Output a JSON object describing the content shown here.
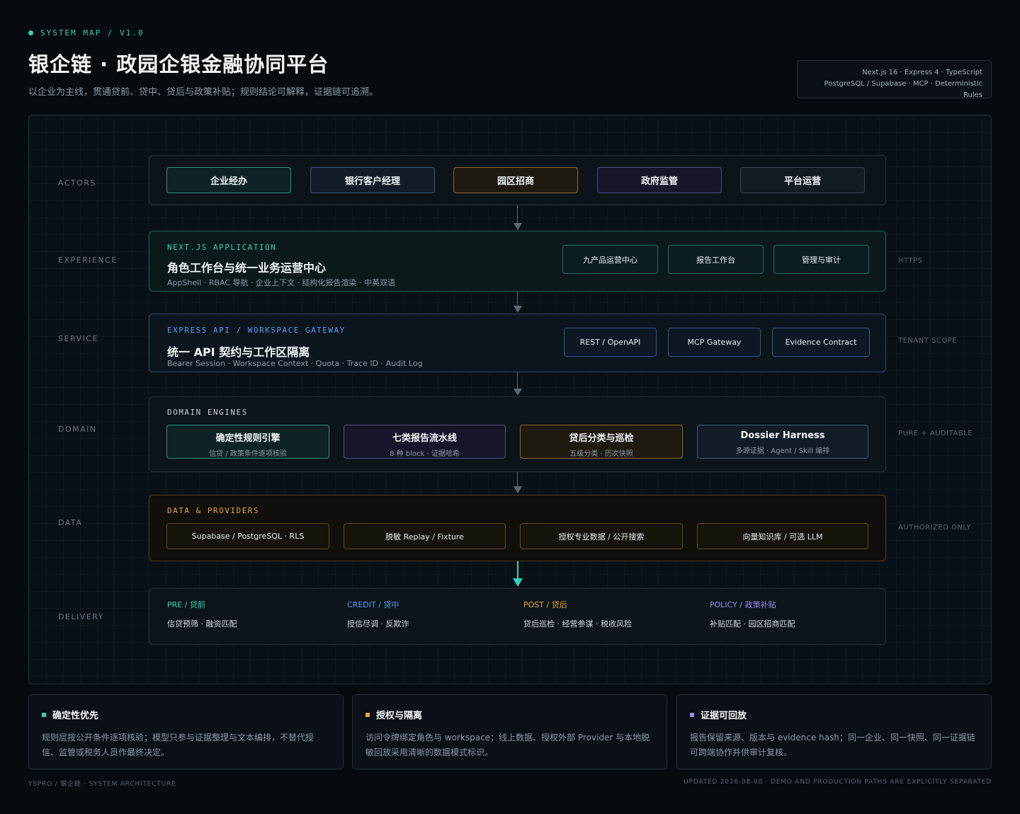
{
  "header": {
    "eyebrow": "SYSTEM MAP / V1.0",
    "title": "银企链 · 政园企银金融协同平台",
    "subtitle": "以企业为主线，贯通贷前、贷中、贷后与政策补贴；规则结论可解释，证据链可追溯。",
    "stack_line1": "Next.js 16 · Express 4 · TypeScript",
    "stack_line2": "PostgreSQL / Supabase · MCP · Deterministic Rules"
  },
  "rows": {
    "actors": "ACTORS",
    "experience": "EXPERIENCE",
    "service": "SERVICE",
    "domain": "DOMAIN",
    "data": "DATA",
    "delivery": "DELIVERY"
  },
  "side": {
    "experience": "HTTPS",
    "service": "TENANT SCOPE",
    "domain": "PURE + AUDITABLE",
    "data": "AUTHORIZED ONLY"
  },
  "actors": [
    {
      "label": "企业经办",
      "color": "#2f8f7e",
      "bg": "#0f2324"
    },
    {
      "label": "银行客户经理",
      "color": "#3d5a7a",
      "bg": "#111c28"
    },
    {
      "label": "园区招商",
      "color": "#8a6a2e",
      "bg": "#1e1a12"
    },
    {
      "label": "政府监管",
      "color": "#4f4e82",
      "bg": "#16162a"
    },
    {
      "label": "平台运营",
      "color": "#3a4550",
      "bg": "#131a20"
    }
  ],
  "experience": {
    "head": "NEXT.JS APPLICATION",
    "title": "角色工作台与统一业务运营中心",
    "sub": "AppShell · RBAC 导航 · 企业上下文 · 结构化报告渲染 · 中英双语",
    "pills": [
      "九产品运营中心",
      "报告工作台",
      "管理与审计"
    ]
  },
  "service": {
    "head": "EXPRESS API / WORKSPACE GATEWAY",
    "title": "统一 API 契约与工作区隔离",
    "sub": "Bearer Session · Workspace Context · Quota · Trace ID · Audit Log",
    "pills": [
      "REST / OpenAPI",
      "MCP Gateway",
      "Evidence Contract"
    ]
  },
  "domain": {
    "head": "DOMAIN ENGINES",
    "engines": [
      {
        "title": "确定性规则引擎",
        "sub": "信贷 / 政策条件逐项核验",
        "color": "#2f8f7e",
        "bg": "#0f2324"
      },
      {
        "title": "七类报告流水线",
        "sub": "8 种 block · 证据哈希",
        "color": "#4f4e82",
        "bg": "#16162a"
      },
      {
        "title": "贷后分类与巡检",
        "sub": "五级分类 · 历次快照",
        "color": "#8a6a2e",
        "bg": "#1e1a12"
      },
      {
        "title": "Dossier Harness",
        "sub": "多源证据 · Agent / Skill 编排",
        "color": "#3d5a7a",
        "bg": "#111c28"
      }
    ]
  },
  "data": {
    "head": "DATA & PROVIDERS",
    "pills": [
      "Supabase / PostgreSQL · RLS",
      "脱敏 Replay / Fixture",
      "授权专业数据 / 公开搜索",
      "向量知识库 / 可选 LLM"
    ]
  },
  "delivery": [
    {
      "head_en": "PRE",
      "head_cn": "贷前",
      "body": "信贷预筛 · 融资匹配",
      "color": "#35d0b6"
    },
    {
      "head_en": "CREDIT",
      "head_cn": "贷中",
      "body": "授信尽调 · 反欺诈",
      "color": "#5b9bf0"
    },
    {
      "head_en": "POST",
      "head_cn": "贷后",
      "body": "贷后巡检 · 经营参谋 · 税收风险",
      "color": "#e0a93c"
    },
    {
      "head_en": "POLICY",
      "head_cn": "政策补贴",
      "body": "补贴匹配 · 园区招商匹配",
      "color": "#9b8cf0"
    }
  ],
  "cards": [
    {
      "title": "确定性优先",
      "body": "规则层按公开条件逐项核验；模型只参与证据整理与文本编排，不替代授信、监管或税务人员作最终决定。",
      "color": "#35d0b6"
    },
    {
      "title": "授权与隔离",
      "body": "访问令牌绑定角色与 workspace；线上数据、授权外部 Provider 与本地脱敏回放采用清晰的数据模式标识。",
      "color": "#e0a93c"
    },
    {
      "title": "证据可回放",
      "body": "报告保留来源、版本与 evidence hash；同一企业、同一快照、同一证据链可跨端协作并供审计复核。",
      "color": "#9b8cf0"
    }
  ],
  "footer": {
    "left": "YSPRO / 银企链 · SYSTEM ARCHITECTURE",
    "right": "UPDATED 2026-08-08 · DEMO AND PRODUCTION PATHS ARE EXPLICITLY SEPARATED"
  },
  "colors": {
    "teal": "#35d0b6",
    "blue": "#5b9bf0",
    "amber": "#e0a93c",
    "violet": "#9b8cf0"
  }
}
